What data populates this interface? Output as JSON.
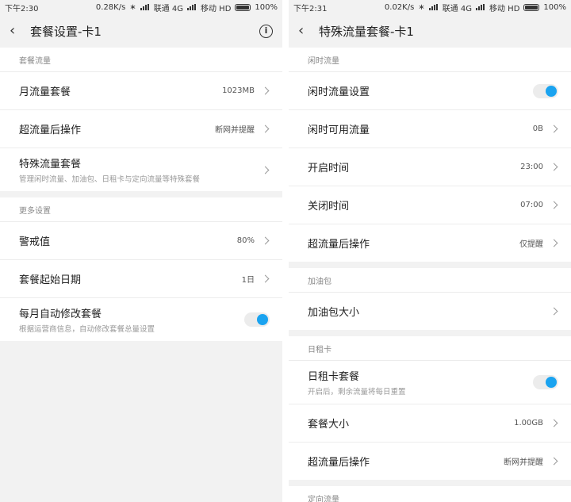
{
  "left": {
    "status": {
      "time": "下午2:30",
      "speed": "0.28K/s",
      "carrier1": "联通 4G",
      "carrier2": "移动 HD",
      "battery": "100%"
    },
    "title": "套餐设置-卡1",
    "sections": [
      {
        "header": "套餐流量",
        "rows": [
          {
            "label": "月流量套餐",
            "value": "1023MB"
          },
          {
            "label": "超流量后操作",
            "value": "断网并提醒"
          },
          {
            "label": "特殊流量套餐",
            "sub": "管理闲时流量、加油包、日租卡与定向流量等特殊套餐"
          }
        ]
      },
      {
        "header": "更多设置",
        "rows": [
          {
            "label": "警戒值",
            "value": "80%"
          },
          {
            "label": "套餐起始日期",
            "value": "1日"
          },
          {
            "label": "每月自动修改套餐",
            "sub": "根据运营商信息，自动修改套餐总量设置",
            "toggle": true
          }
        ]
      }
    ]
  },
  "right": {
    "status": {
      "time": "下午2:31",
      "speed": "0.02K/s",
      "carrier1": "联通 4G",
      "carrier2": "移动 HD",
      "battery": "100%"
    },
    "title": "特殊流量套餐-卡1",
    "sections": [
      {
        "header": "闲时流量",
        "rows": [
          {
            "label": "闲时流量设置",
            "toggle": true
          },
          {
            "label": "闲时可用流量",
            "value": "0B"
          },
          {
            "label": "开启时间",
            "value": "23:00"
          },
          {
            "label": "关闭时间",
            "value": "07:00"
          },
          {
            "label": "超流量后操作",
            "value": "仅提醒"
          }
        ]
      },
      {
        "header": "加油包",
        "rows": [
          {
            "label": "加油包大小"
          }
        ]
      },
      {
        "header": "日租卡",
        "rows": [
          {
            "label": "日租卡套餐",
            "sub": "开启后，剩余流量将每日重置",
            "toggle": true
          },
          {
            "label": "套餐大小",
            "value": "1.00GB"
          },
          {
            "label": "超流量后操作",
            "value": "断网并提醒"
          }
        ]
      },
      {
        "header": "定向流量",
        "rows": []
      }
    ]
  },
  "colors": {
    "accent": "#1aa3f0",
    "background": "#f2f2f2"
  }
}
